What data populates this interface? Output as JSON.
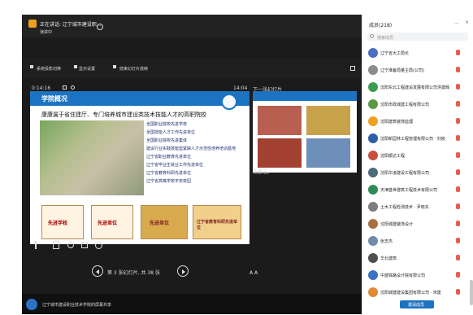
{
  "presenter": {
    "meeting_title": "正在讲话: 辽宁城市建设职...",
    "meeting_sub": "演讲中",
    "toolbar_items": [
      "系统投影切换",
      "显示设置",
      "结束幻灯片放映"
    ],
    "timer": "0:14:16",
    "clock": "14:04",
    "next_label": "下一张幻灯片",
    "notes": "无备注。",
    "nav_text": "第 3 张幻灯片, 共 38 张",
    "share_text": "辽宁城市建设职业技术学院的屏幕共享"
  },
  "slide": {
    "title": "学院概况",
    "subtitle": "康康属于省住建厅、专门培养城市建设类技术技能人才的高职院校",
    "bullets": [
      "全国职业院校先进学校",
      "全国技能人才工作先进单位",
      "全国职业院校先进集体",
      "建设行业实践技能型紧缺人才示范性培养培训基地",
      "辽宁省职业教育先进单位",
      "辽宁省毕业生就业工作先进单位",
      "辽宁省教育科研先进单位",
      "辽宁省高等学校平安校园"
    ],
    "certificates": [
      "先进学校",
      "先进单位",
      "先进单位",
      "辽宁省教育科研先进单位"
    ]
  },
  "sidebar": {
    "title": "成员(218)",
    "search_placeholder": "搜索成员",
    "members": [
      "辽宁省大工局长",
      "辽宁准备局量主局(公司)",
      "沈阳东北工程建设发展有限公司洪建辉",
      "沈阳市政城建工程有限公司",
      "沈阳建筑装饰监理",
      "沈阳新园林工程管理有限公司 · 刘晓",
      "沈阳顺达工程",
      "沈阳华凌建设工程有限公司",
      "天津盛世建筑工程技术有限公司",
      "土木工程检测技术 · 尹晓东",
      "沈阳城建装饰设计",
      "张志杰",
      "华北建筑",
      "中建铁路设计院有限公司",
      "沈阳城建建设集团有限公司 · 宋建"
    ],
    "invite_button": "邀请成员",
    "close": "×",
    "more": "..."
  },
  "colors": {
    "accent": "#1c73c2"
  }
}
